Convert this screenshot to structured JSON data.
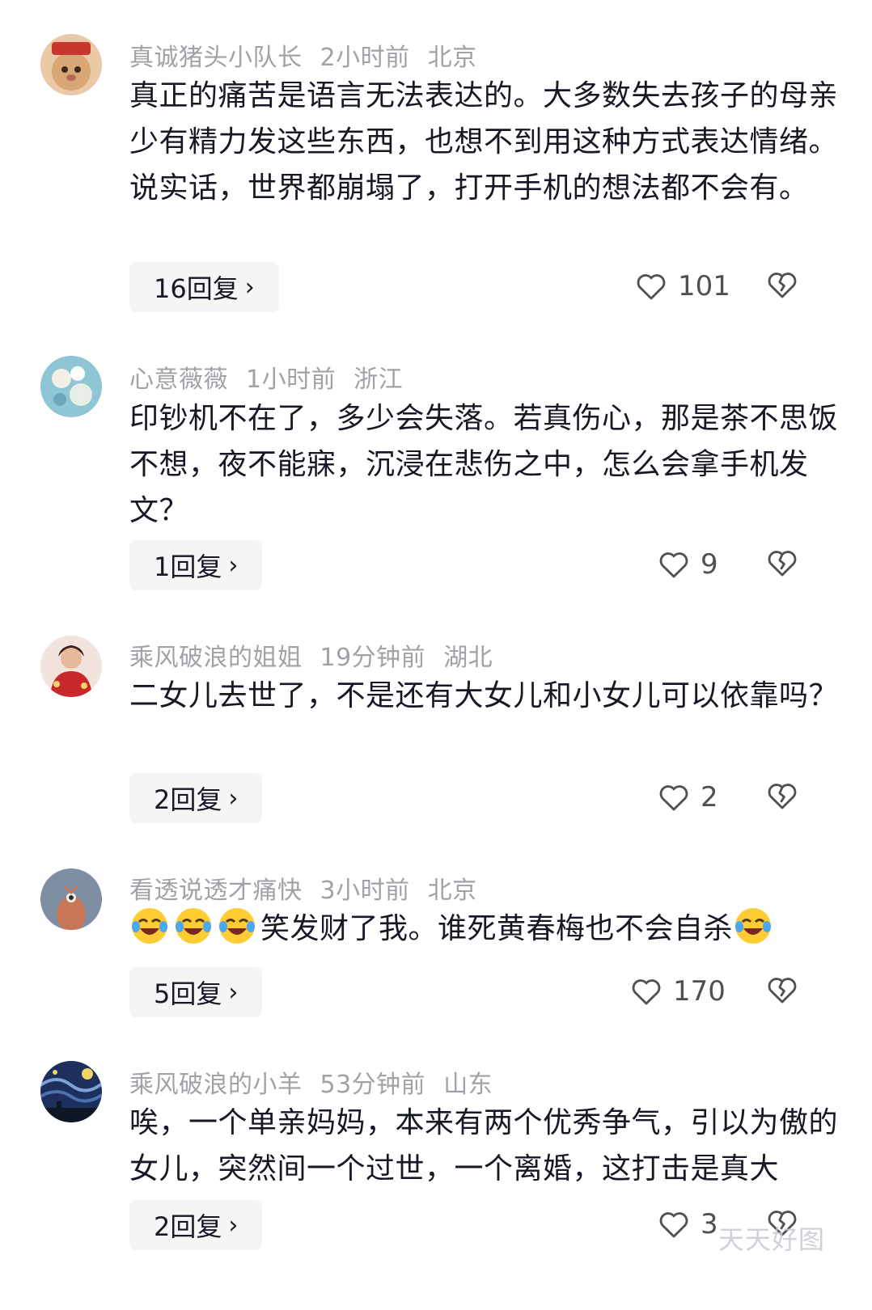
{
  "comments": [
    {
      "username": "真诚猪头小队长",
      "time": "2小时前",
      "location": "北京",
      "text": "真正的痛苦是语言无法表达的。大多数失去孩子的母亲少有精力发这些东西，也想不到用这种方式表达情绪。说实话，世界都崩塌了，打开手机的想法都不会有。",
      "replies": "16回复",
      "likes": "101"
    },
    {
      "username": "心意薇薇",
      "time": "1小时前",
      "location": "浙江",
      "text": "印钞机不在了，多少会失落。若真伤心，那是茶不思饭不想，夜不能寐，沉浸在悲伤之中，怎么会拿手机发文？",
      "replies": "1回复",
      "likes": "9"
    },
    {
      "username": "乘风破浪的姐姐",
      "time": "19分钟前",
      "location": "湖北",
      "text": "二女儿去世了，不是还有大女儿和小女儿可以依靠吗？",
      "replies": "2回复",
      "likes": "2"
    },
    {
      "username": "看透说透才痛快",
      "time": "3小时前",
      "location": "北京",
      "text": "笑发财了我。谁死黄春梅也不会自杀",
      "replies": "5回复",
      "likes": "170"
    },
    {
      "username": "乘风破浪的小羊",
      "time": "53分钟前",
      "location": "山东",
      "text": "唉，一个单亲妈妈，本来有两个优秀争气，引以为傲的女儿，突然间一个过世，一个离婚，这打击是真大",
      "replies": "2回复",
      "likes": "3"
    }
  ],
  "icons": {
    "like": "heart-outline-icon",
    "dislike": "broken-heart-icon",
    "reply_arrow": "chevron-right-icon",
    "emoji": "laughing-crying-emoji"
  },
  "watermark": "天天好图",
  "colors": {
    "meta": "#a1a2a7",
    "text": "#161823",
    "reply_bg": "#f5f5f6"
  }
}
